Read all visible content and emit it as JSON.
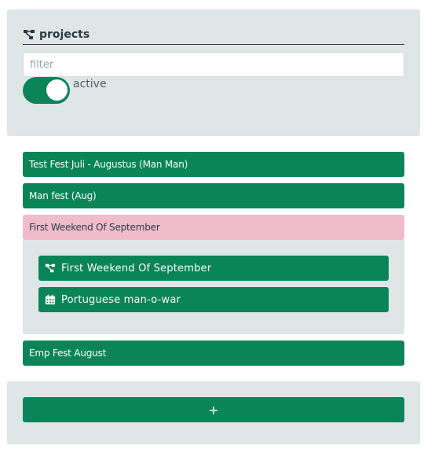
{
  "header": {
    "icon": "project-tree-icon",
    "title": "projects"
  },
  "filter": {
    "placeholder": "filter",
    "value": ""
  },
  "active_toggle": {
    "label": "active",
    "on": true
  },
  "projects": [
    {
      "label": "Test Fest Juli - Augustus (Man Man)",
      "state": "default"
    },
    {
      "label": "Man fest (Aug)",
      "state": "default"
    },
    {
      "label": "First Weekend Of September",
      "state": "expanded",
      "children": [
        {
          "icon": "project-tree-icon",
          "label": "First Weekend Of September"
        },
        {
          "icon": "calendar-icon",
          "label": "Portuguese man-o-war"
        }
      ]
    },
    {
      "label": "Emp Fest August",
      "state": "default"
    }
  ],
  "add_button": {
    "label": "+"
  },
  "colors": {
    "accent_green": "#0a8458",
    "selected_pink": "#f0bccb",
    "panel_bg": "#dfe7e6",
    "text_dark": "#2c3844"
  }
}
